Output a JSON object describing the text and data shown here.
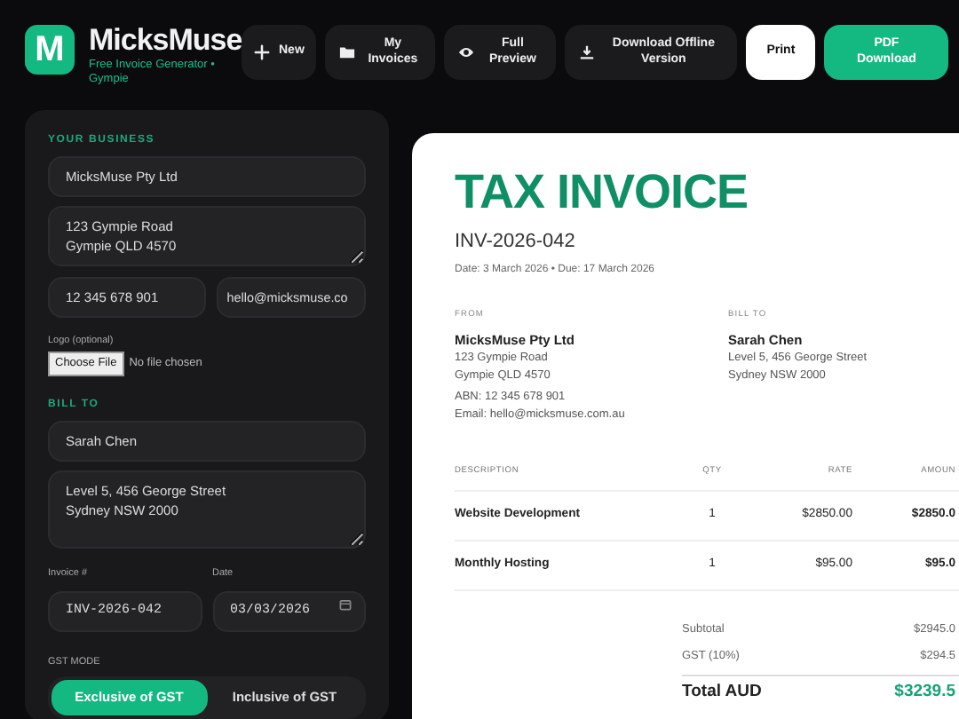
{
  "brand": {
    "initial": "M",
    "name": "MicksMuse",
    "tagline": "Free Invoice Generator • Gympie"
  },
  "toolbar": [
    {
      "label": "New"
    },
    {
      "label": "My Invoices"
    },
    {
      "label": "Full Preview"
    },
    {
      "label": "Download Offline Version"
    },
    {
      "label": "Print"
    },
    {
      "label": "PDF Download"
    }
  ],
  "business": {
    "heading": "YOUR BUSINESS",
    "name": "MicksMuse Pty Ltd",
    "address": "123 Gympie Road\nGympie QLD 4570",
    "abn": "12 345 678 901",
    "email": "hello@micksmuse.co",
    "logo_label": "Logo (optional)",
    "file_button": "Choose File",
    "file_status": "No file chosen"
  },
  "bill_to": {
    "heading": "BILL TO",
    "name": "Sarah Chen",
    "address": "Level 5, 456 George Street\nSydney NSW 2000"
  },
  "invoice_fields": [
    {
      "label": "Invoice #",
      "value": "INV-2026-042",
      "kind": "text"
    },
    {
      "label": "Date",
      "value": "03/03/2026",
      "kind": "date"
    }
  ],
  "gst_mode": {
    "label": "GST MODE",
    "options": [
      {
        "label": "Exclusive of GST",
        "selected": true
      },
      {
        "label": "Inclusive of GST",
        "selected": false
      }
    ]
  },
  "preview": {
    "title": "TAX INVOICE",
    "number": "INV-2026-042",
    "dates": "Date: 3 March 2026 • Due: 17 March 2026",
    "parties": [
      {
        "heading": "FROM",
        "name": "MicksMuse Pty Ltd",
        "lines": [
          "123 Gympie Road",
          "Gympie QLD 4570"
        ],
        "extra": [
          "ABN: 12 345 678 901",
          "Email: hello@micksmuse.com.au"
        ]
      },
      {
        "heading": "BILL TO",
        "name": "Sarah Chen",
        "lines": [
          "Level 5, 456 George Street",
          "Sydney NSW 2000"
        ]
      }
    ],
    "table": {
      "columns": [
        "DESCRIPTION",
        "QTY",
        "RATE",
        "AMOUN"
      ],
      "rows": [
        [
          "Website Development",
          "1",
          "$2850.00",
          "$2850.0"
        ],
        [
          "Monthly Hosting",
          "1",
          "$95.00",
          "$95.0"
        ]
      ]
    },
    "totals": [
      {
        "label": "Subtotal",
        "value": "$2945.0",
        "kind": "line"
      },
      {
        "label": "GST (10%)",
        "value": "$294.5",
        "kind": "line"
      },
      {
        "label": "Total AUD",
        "value": "$3239.5",
        "kind": "grand"
      }
    ]
  }
}
